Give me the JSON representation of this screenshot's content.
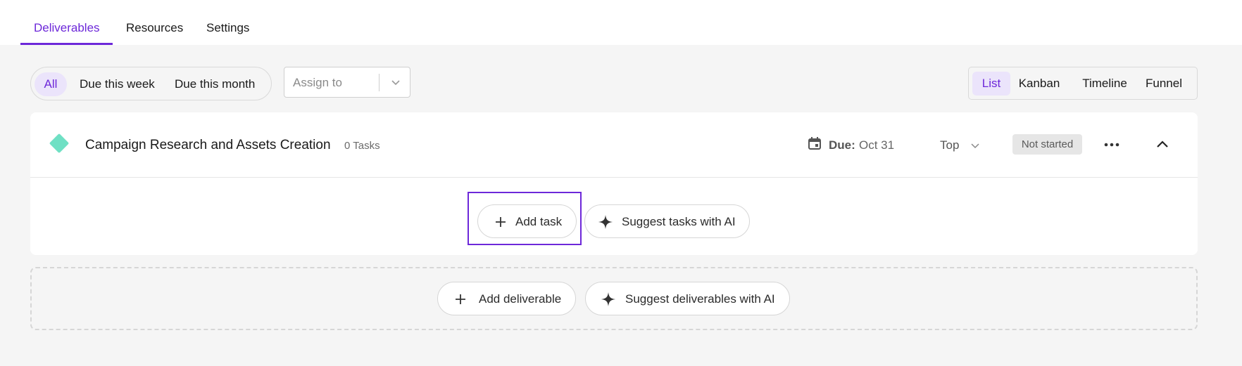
{
  "top_tabs": [
    {
      "label": "Deliverables",
      "active": true
    },
    {
      "label": "Resources",
      "active": false
    },
    {
      "label": "Settings",
      "active": false
    }
  ],
  "filters": [
    {
      "label": "All",
      "active": true
    },
    {
      "label": "Due this week",
      "active": false
    },
    {
      "label": "Due this month",
      "active": false
    }
  ],
  "assign": {
    "placeholder": "Assign to"
  },
  "views": [
    {
      "label": "List",
      "active": true
    },
    {
      "label": "Kanban",
      "active": false
    },
    {
      "label": "Timeline",
      "active": false
    },
    {
      "label": "Funnel",
      "active": false
    }
  ],
  "deliverable": {
    "title": "Campaign Research and Assets Creation",
    "tasks_count": "0 Tasks",
    "due_label": "Due:",
    "due_value": "Oct 31",
    "priority": "Top",
    "status": "Not started",
    "add_task_label": "Add task",
    "suggest_tasks_label": "Suggest tasks with AI"
  },
  "footer": {
    "add_deliverable_label": "Add deliverable",
    "suggest_deliverables_label": "Suggest deliverables with AI"
  },
  "colors": {
    "accent": "#6d28d9",
    "accent_light": "#ebe4fb",
    "diamond": "#6fe0c4",
    "background": "#f5f5f5"
  },
  "icons": [
    "plus-icon",
    "sparkle-icon",
    "calendar-icon",
    "chevron-down-icon",
    "more-icon",
    "chevron-up-icon"
  ]
}
